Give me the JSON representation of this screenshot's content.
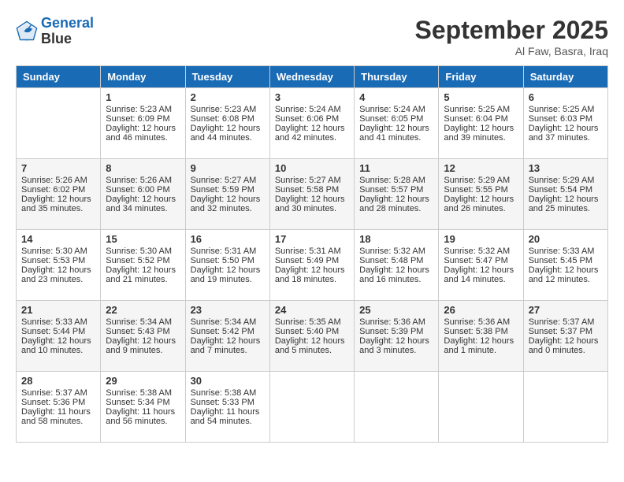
{
  "header": {
    "logo_line1": "General",
    "logo_line2": "Blue",
    "month": "September 2025",
    "location": "Al Faw, Basra, Iraq"
  },
  "days_of_week": [
    "Sunday",
    "Monday",
    "Tuesday",
    "Wednesday",
    "Thursday",
    "Friday",
    "Saturday"
  ],
  "weeks": [
    [
      {
        "num": "",
        "sunrise": "",
        "sunset": "",
        "daylight": ""
      },
      {
        "num": "1",
        "sunrise": "Sunrise: 5:23 AM",
        "sunset": "Sunset: 6:09 PM",
        "daylight": "Daylight: 12 hours and 46 minutes."
      },
      {
        "num": "2",
        "sunrise": "Sunrise: 5:23 AM",
        "sunset": "Sunset: 6:08 PM",
        "daylight": "Daylight: 12 hours and 44 minutes."
      },
      {
        "num": "3",
        "sunrise": "Sunrise: 5:24 AM",
        "sunset": "Sunset: 6:06 PM",
        "daylight": "Daylight: 12 hours and 42 minutes."
      },
      {
        "num": "4",
        "sunrise": "Sunrise: 5:24 AM",
        "sunset": "Sunset: 6:05 PM",
        "daylight": "Daylight: 12 hours and 41 minutes."
      },
      {
        "num": "5",
        "sunrise": "Sunrise: 5:25 AM",
        "sunset": "Sunset: 6:04 PM",
        "daylight": "Daylight: 12 hours and 39 minutes."
      },
      {
        "num": "6",
        "sunrise": "Sunrise: 5:25 AM",
        "sunset": "Sunset: 6:03 PM",
        "daylight": "Daylight: 12 hours and 37 minutes."
      }
    ],
    [
      {
        "num": "7",
        "sunrise": "Sunrise: 5:26 AM",
        "sunset": "Sunset: 6:02 PM",
        "daylight": "Daylight: 12 hours and 35 minutes."
      },
      {
        "num": "8",
        "sunrise": "Sunrise: 5:26 AM",
        "sunset": "Sunset: 6:00 PM",
        "daylight": "Daylight: 12 hours and 34 minutes."
      },
      {
        "num": "9",
        "sunrise": "Sunrise: 5:27 AM",
        "sunset": "Sunset: 5:59 PM",
        "daylight": "Daylight: 12 hours and 32 minutes."
      },
      {
        "num": "10",
        "sunrise": "Sunrise: 5:27 AM",
        "sunset": "Sunset: 5:58 PM",
        "daylight": "Daylight: 12 hours and 30 minutes."
      },
      {
        "num": "11",
        "sunrise": "Sunrise: 5:28 AM",
        "sunset": "Sunset: 5:57 PM",
        "daylight": "Daylight: 12 hours and 28 minutes."
      },
      {
        "num": "12",
        "sunrise": "Sunrise: 5:29 AM",
        "sunset": "Sunset: 5:55 PM",
        "daylight": "Daylight: 12 hours and 26 minutes."
      },
      {
        "num": "13",
        "sunrise": "Sunrise: 5:29 AM",
        "sunset": "Sunset: 5:54 PM",
        "daylight": "Daylight: 12 hours and 25 minutes."
      }
    ],
    [
      {
        "num": "14",
        "sunrise": "Sunrise: 5:30 AM",
        "sunset": "Sunset: 5:53 PM",
        "daylight": "Daylight: 12 hours and 23 minutes."
      },
      {
        "num": "15",
        "sunrise": "Sunrise: 5:30 AM",
        "sunset": "Sunset: 5:52 PM",
        "daylight": "Daylight: 12 hours and 21 minutes."
      },
      {
        "num": "16",
        "sunrise": "Sunrise: 5:31 AM",
        "sunset": "Sunset: 5:50 PM",
        "daylight": "Daylight: 12 hours and 19 minutes."
      },
      {
        "num": "17",
        "sunrise": "Sunrise: 5:31 AM",
        "sunset": "Sunset: 5:49 PM",
        "daylight": "Daylight: 12 hours and 18 minutes."
      },
      {
        "num": "18",
        "sunrise": "Sunrise: 5:32 AM",
        "sunset": "Sunset: 5:48 PM",
        "daylight": "Daylight: 12 hours and 16 minutes."
      },
      {
        "num": "19",
        "sunrise": "Sunrise: 5:32 AM",
        "sunset": "Sunset: 5:47 PM",
        "daylight": "Daylight: 12 hours and 14 minutes."
      },
      {
        "num": "20",
        "sunrise": "Sunrise: 5:33 AM",
        "sunset": "Sunset: 5:45 PM",
        "daylight": "Daylight: 12 hours and 12 minutes."
      }
    ],
    [
      {
        "num": "21",
        "sunrise": "Sunrise: 5:33 AM",
        "sunset": "Sunset: 5:44 PM",
        "daylight": "Daylight: 12 hours and 10 minutes."
      },
      {
        "num": "22",
        "sunrise": "Sunrise: 5:34 AM",
        "sunset": "Sunset: 5:43 PM",
        "daylight": "Daylight: 12 hours and 9 minutes."
      },
      {
        "num": "23",
        "sunrise": "Sunrise: 5:34 AM",
        "sunset": "Sunset: 5:42 PM",
        "daylight": "Daylight: 12 hours and 7 minutes."
      },
      {
        "num": "24",
        "sunrise": "Sunrise: 5:35 AM",
        "sunset": "Sunset: 5:40 PM",
        "daylight": "Daylight: 12 hours and 5 minutes."
      },
      {
        "num": "25",
        "sunrise": "Sunrise: 5:36 AM",
        "sunset": "Sunset: 5:39 PM",
        "daylight": "Daylight: 12 hours and 3 minutes."
      },
      {
        "num": "26",
        "sunrise": "Sunrise: 5:36 AM",
        "sunset": "Sunset: 5:38 PM",
        "daylight": "Daylight: 12 hours and 1 minute."
      },
      {
        "num": "27",
        "sunrise": "Sunrise: 5:37 AM",
        "sunset": "Sunset: 5:37 PM",
        "daylight": "Daylight: 12 hours and 0 minutes."
      }
    ],
    [
      {
        "num": "28",
        "sunrise": "Sunrise: 5:37 AM",
        "sunset": "Sunset: 5:36 PM",
        "daylight": "Daylight: 11 hours and 58 minutes."
      },
      {
        "num": "29",
        "sunrise": "Sunrise: 5:38 AM",
        "sunset": "Sunset: 5:34 PM",
        "daylight": "Daylight: 11 hours and 56 minutes."
      },
      {
        "num": "30",
        "sunrise": "Sunrise: 5:38 AM",
        "sunset": "Sunset: 5:33 PM",
        "daylight": "Daylight: 11 hours and 54 minutes."
      },
      {
        "num": "",
        "sunrise": "",
        "sunset": "",
        "daylight": ""
      },
      {
        "num": "",
        "sunrise": "",
        "sunset": "",
        "daylight": ""
      },
      {
        "num": "",
        "sunrise": "",
        "sunset": "",
        "daylight": ""
      },
      {
        "num": "",
        "sunrise": "",
        "sunset": "",
        "daylight": ""
      }
    ]
  ]
}
